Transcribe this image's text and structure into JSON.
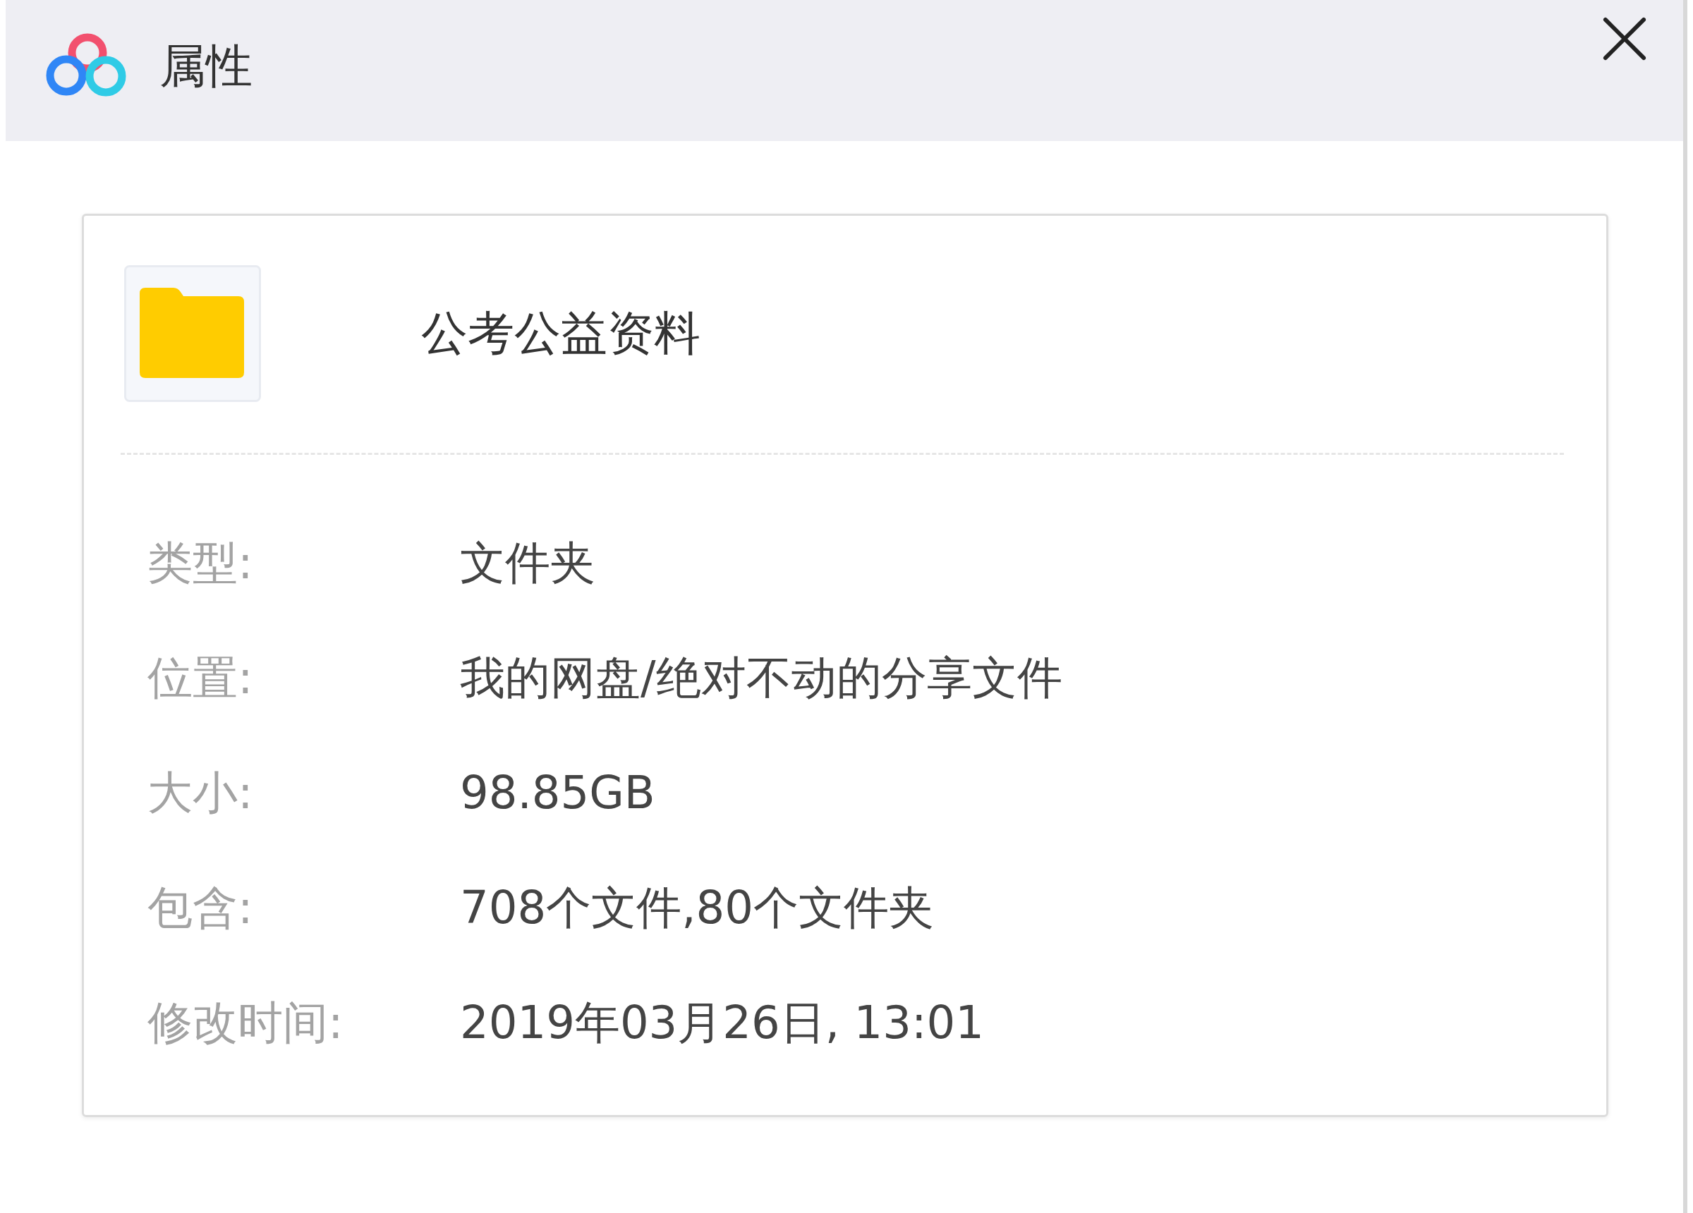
{
  "window": {
    "title": "属性"
  },
  "item": {
    "name": "公考公益资料"
  },
  "properties": [
    {
      "label": "类型:",
      "value": "文件夹"
    },
    {
      "label": "位置:",
      "value": "我的网盘/绝对不动的分享文件"
    },
    {
      "label": "大小:",
      "value": "98.85GB"
    },
    {
      "label": "包含:",
      "value": "708个文件,80个文件夹"
    },
    {
      "label": "修改时间:",
      "value": "2019年03月26日, 13:01"
    }
  ]
}
